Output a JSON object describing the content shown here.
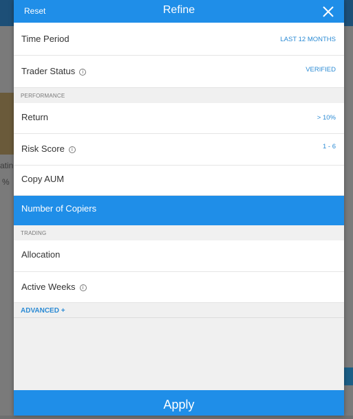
{
  "header": {
    "reset_label": "Reset",
    "title": "Refine",
    "close_icon": "close-icon"
  },
  "rows": {
    "time_period": {
      "label": "Time Period",
      "value": "LAST 12 MONTHS"
    },
    "trader_status": {
      "label": "Trader Status",
      "value": "VERIFIED"
    },
    "return": {
      "label": "Return",
      "value": "> 10%"
    },
    "risk_score": {
      "label": "Risk Score",
      "value": "1 - 6"
    },
    "copy_aum": {
      "label": "Copy AUM"
    },
    "number_of_copiers": {
      "label": "Number of Copiers"
    },
    "allocation": {
      "label": "Allocation"
    },
    "active_weeks": {
      "label": "Active Weeks"
    }
  },
  "sections": {
    "performance": "PERFORMANCE",
    "trading": "TRADING"
  },
  "advanced": {
    "label": "ADVANCED +"
  },
  "info_icon_glyph": "i",
  "apply_label": "Apply",
  "background_fragments": {
    "rating": "atin",
    "percent": "%"
  },
  "colors": {
    "accent": "#1f8ee8",
    "value_text": "#2a8ad4",
    "row_bg": "#ffffff",
    "panel_bg": "#f0f0f0"
  }
}
